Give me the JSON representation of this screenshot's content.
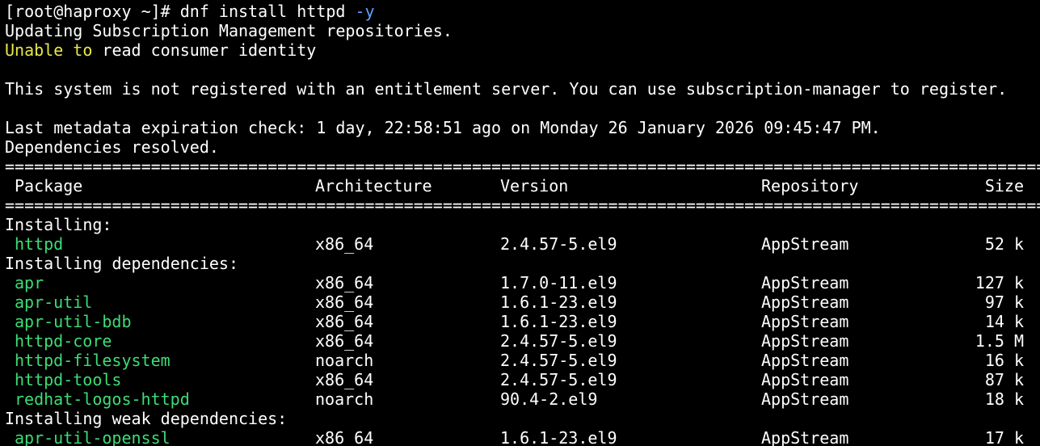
{
  "terminal": {
    "prompt": "[root@haproxy ~]# ",
    "command": "dnf install httpd",
    "command_flag": "-y",
    "lines": {
      "updating": "Updating Subscription Management repositories.",
      "unable_word": "Unable to",
      "unable_rest": " read consumer identity",
      "not_registered": "This system is not registered with an entitlement server. You can use subscription-manager to register.",
      "metadata": "Last metadata expiration check: 1 day, 22:58:51 ago on Monday 26 January 2026 09:45:47 PM.",
      "deps_resolved": "Dependencies resolved."
    },
    "rule": "==============================================================================================================================================================================",
    "table": {
      "headers": {
        "package": "Package",
        "architecture": "Architecture",
        "version": "Version",
        "repository": "Repository",
        "size": "Size"
      },
      "sections": [
        {
          "title": "Installing:",
          "rows": [
            {
              "package": "httpd",
              "arch": "x86_64",
              "version": "2.4.57-5.el9",
              "repo": "AppStream",
              "size": "52 k"
            }
          ]
        },
        {
          "title": "Installing dependencies:",
          "rows": [
            {
              "package": "apr",
              "arch": "x86_64",
              "version": "1.7.0-11.el9",
              "repo": "AppStream",
              "size": "127 k"
            },
            {
              "package": "apr-util",
              "arch": "x86_64",
              "version": "1.6.1-23.el9",
              "repo": "AppStream",
              "size": "97 k"
            },
            {
              "package": "apr-util-bdb",
              "arch": "x86_64",
              "version": "1.6.1-23.el9",
              "repo": "AppStream",
              "size": "14 k"
            },
            {
              "package": "httpd-core",
              "arch": "x86_64",
              "version": "2.4.57-5.el9",
              "repo": "AppStream",
              "size": "1.5 M"
            },
            {
              "package": "httpd-filesystem",
              "arch": "noarch",
              "version": "2.4.57-5.el9",
              "repo": "AppStream",
              "size": "16 k"
            },
            {
              "package": "httpd-tools",
              "arch": "x86_64",
              "version": "2.4.57-5.el9",
              "repo": "AppStream",
              "size": "87 k"
            },
            {
              "package": "redhat-logos-httpd",
              "arch": "noarch",
              "version": "90.4-2.el9",
              "repo": "AppStream",
              "size": "18 k"
            }
          ]
        },
        {
          "title": "Installing weak dependencies:",
          "rows": [
            {
              "package": "apr-util-openssl",
              "arch": "x86_64",
              "version": "1.6.1-23.el9",
              "repo": "AppStream",
              "size": "17 k"
            }
          ]
        }
      ]
    }
  }
}
